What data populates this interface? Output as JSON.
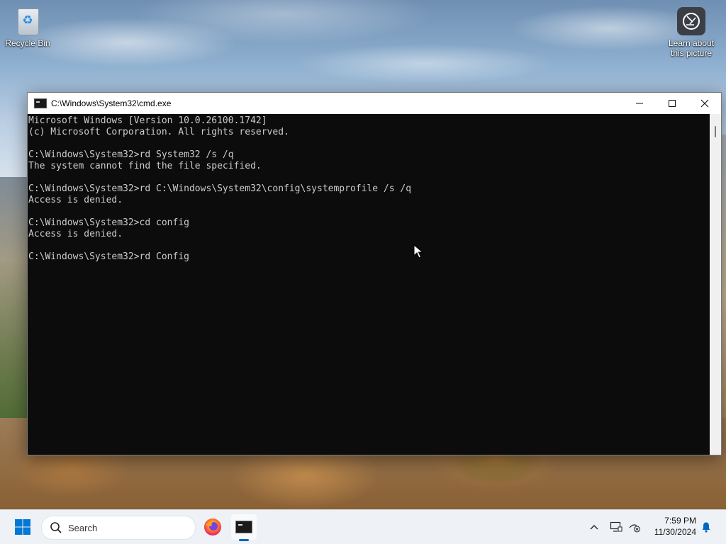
{
  "desktop": {
    "icons": [
      {
        "label": "Recycle Bin",
        "icon": "recycle-bin-icon"
      },
      {
        "label": "Learn about this picture",
        "icon": "camera-lens-icon"
      }
    ]
  },
  "window": {
    "title": "C:\\Windows\\System32\\cmd.exe",
    "controls": {
      "minimize": "minimize-icon",
      "maximize": "maximize-icon",
      "close": "close-icon"
    },
    "console_lines": [
      "Microsoft Windows [Version 10.0.26100.1742]",
      "(c) Microsoft Corporation. All rights reserved.",
      "",
      "C:\\Windows\\System32>rd System32 /s /q",
      "The system cannot find the file specified.",
      "",
      "C:\\Windows\\System32>rd C:\\Windows\\System32\\config\\systemprofile /s /q",
      "Access is denied.",
      "",
      "C:\\Windows\\System32>cd config",
      "Access is denied.",
      "",
      "C:\\Windows\\System32>rd Config"
    ]
  },
  "taskbar": {
    "search_placeholder": "Search",
    "apps": [
      {
        "name": "Firefox",
        "icon": "firefox-icon"
      },
      {
        "name": "Command Prompt",
        "icon": "cmd-icon",
        "active": true
      }
    ],
    "tray": {
      "chevron": "^",
      "time": "7:59 PM",
      "date": "11/30/2024"
    }
  },
  "colors": {
    "console_bg": "#0c0c0c",
    "console_text": "#cccccc",
    "accent": "#0067c0",
    "start_blue": "#0078d4"
  }
}
